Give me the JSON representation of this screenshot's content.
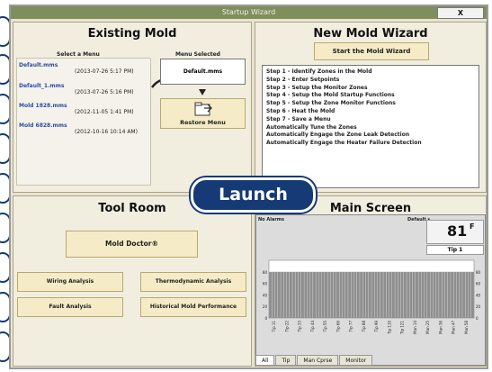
{
  "window": {
    "title": "Startup Wizard",
    "close_label": "X"
  },
  "existing_mold": {
    "title": "Existing Mold",
    "select_label": "Select a Menu",
    "selected_label": "Menu Selected",
    "menus": [
      {
        "name": "Default.mms",
        "date": "(2013-07-26  5:17 PM)"
      },
      {
        "name": "Default_1.mms",
        "date": "(2013-07-26  5:16 PM)"
      },
      {
        "name": "Mold 1828.mms",
        "date": "(2012-11-05  1:41 PM)"
      },
      {
        "name": "Mold 6828.mms",
        "date": "(2012-10-16  10:14 AM)"
      }
    ],
    "selected_value": "Default.mms",
    "restore_label": "Restore Menu"
  },
  "new_mold": {
    "title": "New Mold Wizard",
    "start_label": "Start the Mold Wizard",
    "steps": [
      "Step 1 - Identify Zones in the Mold",
      "Step 2 - Enter Setpoints",
      "Step 3 - Setup the Monitor Zones",
      "Step 4 - Setup the Mold Startup Functions",
      "Step 5 - Setup the Zone Monitor Functions",
      "Step 6 - Heat the Mold",
      "Step 7 - Save a Menu",
      "Automatically Tune the Zones",
      "Automatically Engage the Zone Leak Detection",
      "Automatically Engage the Heater Failure Detection"
    ]
  },
  "tool_room": {
    "title": "Tool Room",
    "mold_doctor": "Mold Doctor®",
    "wiring": "Wiring Analysis",
    "thermo": "Thermodynamic Analysis",
    "fault": "Fault Analysis",
    "historical": "Historical Mold Performance"
  },
  "launch_label": "Launch",
  "main_screen": {
    "title": "Main Screen",
    "alarms": "No Alarms",
    "default_label": "Default ▾",
    "temperature": "81",
    "unit": "F",
    "zone": "Tip 1",
    "tabs": [
      "All",
      "Tip",
      "Man Cprse",
      "Monitor"
    ]
  },
  "chart_data": {
    "type": "bar",
    "categories": [
      "Tip 11",
      "Tip 22",
      "Tip 33",
      "Tip 44",
      "Tip 55",
      "Tip 66",
      "Tip 77",
      "Tip 88",
      "Tip 99",
      "Tip 110",
      "Tip 121",
      "Man 14",
      "Man 25",
      "Man 36",
      "Man 47",
      "Man 58"
    ],
    "values": [
      80,
      80,
      80,
      80,
      80,
      80,
      80,
      80,
      80,
      80,
      80,
      80,
      80,
      80,
      80,
      80
    ],
    "y_ticks": [
      0,
      20,
      40,
      60,
      80
    ],
    "ylim": [
      0,
      100
    ],
    "bar_count": 70,
    "bar_color": "#8f8f8f"
  }
}
